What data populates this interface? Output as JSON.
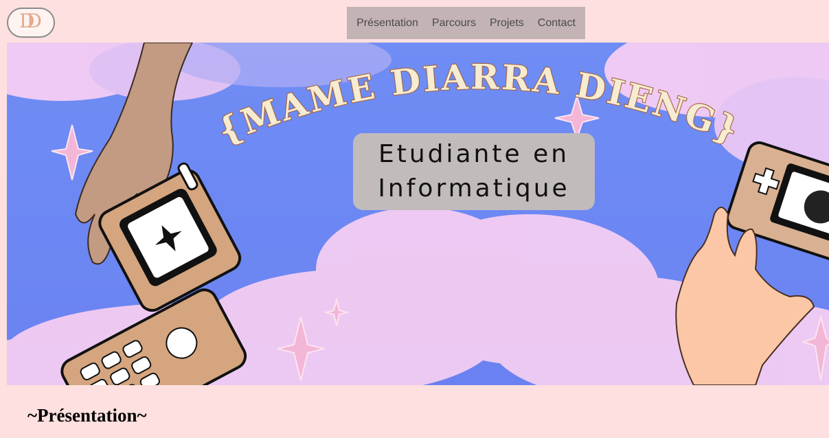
{
  "header": {
    "logo_text": "DD",
    "nav": [
      {
        "label": "Présentation"
      },
      {
        "label": "Parcours"
      },
      {
        "label": "Projets"
      },
      {
        "label": "Contact"
      }
    ]
  },
  "banner": {
    "title": "~{MAME DIARRA DIENG}~",
    "subtitle_line1": "Etudiante en",
    "subtitle_line2": "Informatique"
  },
  "main": {
    "section_title": "~Présentation~"
  },
  "colors": {
    "page_bg": "#fde0df",
    "nav_bg": "#c4b3b4",
    "sky": "#6e88f4",
    "cloud": "#f6cdf2",
    "title_fill": "#f5ecd2",
    "title_stroke": "#a5603b"
  }
}
